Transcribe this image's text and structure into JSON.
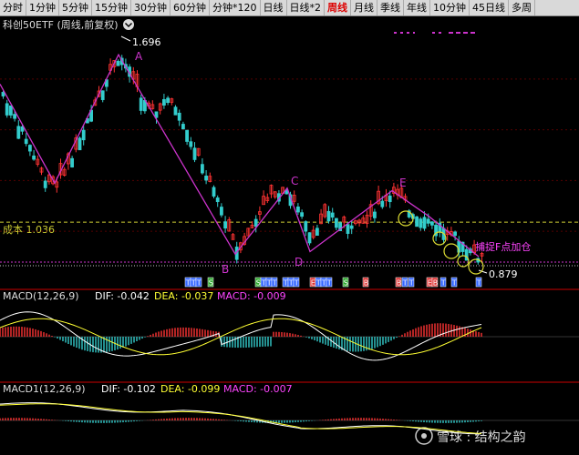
{
  "toolbar": [
    {
      "label": "分时",
      "active": false
    },
    {
      "label": "1分钟",
      "active": false
    },
    {
      "label": "5分钟",
      "active": false
    },
    {
      "label": "15分钟",
      "active": false
    },
    {
      "label": "30分钟",
      "active": false
    },
    {
      "label": "60分钟",
      "active": false
    },
    {
      "label": "分钟*120",
      "active": false
    },
    {
      "label": "日线",
      "active": false
    },
    {
      "label": "日线*2",
      "active": false
    },
    {
      "label": "周线",
      "active": true
    },
    {
      "label": "月线",
      "active": false
    },
    {
      "label": "季线",
      "active": false
    },
    {
      "label": "年线",
      "active": false
    },
    {
      "label": "10分钟",
      "active": false
    },
    {
      "label": "45日线",
      "active": false
    },
    {
      "label": "多周",
      "active": false
    }
  ],
  "main": {
    "title": "科创50ETF (周线,前复权)",
    "cost_label": "成本 1.036",
    "annotation": "捕捉F点加仓",
    "high_label": "1.696",
    "low_label": "0.879",
    "wave_labels": [
      "A",
      "B",
      "C",
      "D",
      "E"
    ]
  },
  "macd_panels": [
    {
      "header": "MACD(12,26,9)",
      "dif_label": "DIF: -0.042",
      "dea_label": "DEA: -0.037",
      "macd_label": "MACD: -0.009"
    },
    {
      "header": "MACD1(12,26,9)",
      "dif_label": "DIF: -0.102",
      "dea_label": "DEA: -0.099",
      "macd_label": "MACD: -0.007"
    }
  ],
  "watermark": "雪球 : 结构之韵",
  "colors": {
    "up": "#ff3333",
    "down": "#33cccc",
    "wave": "#cc33cc",
    "dif": "#ffffff",
    "dea": "#ffff33",
    "cost": "#cccc33",
    "annotation": "#ff44ff",
    "circle": "#dddd33"
  },
  "signal_markers": [
    "T",
    "T",
    "T",
    "S",
    "S",
    "T",
    "T",
    "T",
    "T",
    "T",
    "T",
    "E",
    "T",
    "T",
    "T",
    "S",
    "B",
    "B",
    "T",
    "T",
    "E",
    "B",
    "T",
    "T",
    "T"
  ],
  "chart_data": {
    "type": "candlestick",
    "title": "科创50ETF (周线,前复权)",
    "ylim": [
      0.85,
      1.75
    ],
    "price_path": [
      [
        0,
        1.56
      ],
      [
        14,
        1.46
      ],
      [
        30,
        1.35
      ],
      [
        45,
        1.22
      ],
      [
        60,
        1.18
      ],
      [
        75,
        1.27
      ],
      [
        90,
        1.39
      ],
      [
        100,
        1.49
      ],
      [
        110,
        1.56
      ],
      [
        120,
        1.63
      ],
      [
        130,
        1.696
      ],
      [
        140,
        1.64
      ],
      [
        150,
        1.56
      ],
      [
        160,
        1.49
      ],
      [
        170,
        1.47
      ],
      [
        180,
        1.52
      ],
      [
        190,
        1.5
      ],
      [
        200,
        1.42
      ],
      [
        210,
        1.34
      ],
      [
        220,
        1.26
      ],
      [
        230,
        1.18
      ],
      [
        240,
        1.11
      ],
      [
        250,
        1.0
      ],
      [
        260,
        0.93
      ],
      [
        270,
        0.97
      ],
      [
        280,
        1.06
      ],
      [
        290,
        1.11
      ],
      [
        300,
        1.15
      ],
      [
        315,
        1.17
      ],
      [
        320,
        1.12
      ],
      [
        330,
        1.06
      ],
      [
        340,
        0.98
      ],
      [
        350,
        1.03
      ],
      [
        360,
        1.07
      ],
      [
        370,
        1.05
      ],
      [
        380,
        1.02
      ],
      [
        390,
        1.05
      ],
      [
        400,
        1.04
      ],
      [
        410,
        1.09
      ],
      [
        420,
        1.12
      ],
      [
        430,
        1.16
      ],
      [
        440,
        1.12
      ],
      [
        450,
        1.08
      ],
      [
        460,
        1.06
      ],
      [
        470,
        1.04
      ],
      [
        480,
        1.03
      ],
      [
        490,
        1.0
      ],
      [
        500,
        0.98
      ],
      [
        510,
        0.94
      ],
      [
        520,
        0.91
      ],
      [
        525,
        0.9
      ]
    ],
    "wave_points": [
      {
        "label": "A",
        "price": 1.696
      },
      {
        "label": "B",
        "price": 0.91
      },
      {
        "label": "C",
        "price": 1.17
      },
      {
        "label": "D",
        "price": 0.92
      },
      {
        "label": "E",
        "price": 1.16
      },
      {
        "label": "F",
        "price": 0.879
      }
    ],
    "cost_level": 1.036,
    "high": 1.696,
    "low": 0.879,
    "macd": {
      "dif": -0.042,
      "dea": -0.037,
      "macd": -0.009
    },
    "macd1": {
      "dif": -0.102,
      "dea": -0.099,
      "macd": -0.007
    }
  }
}
